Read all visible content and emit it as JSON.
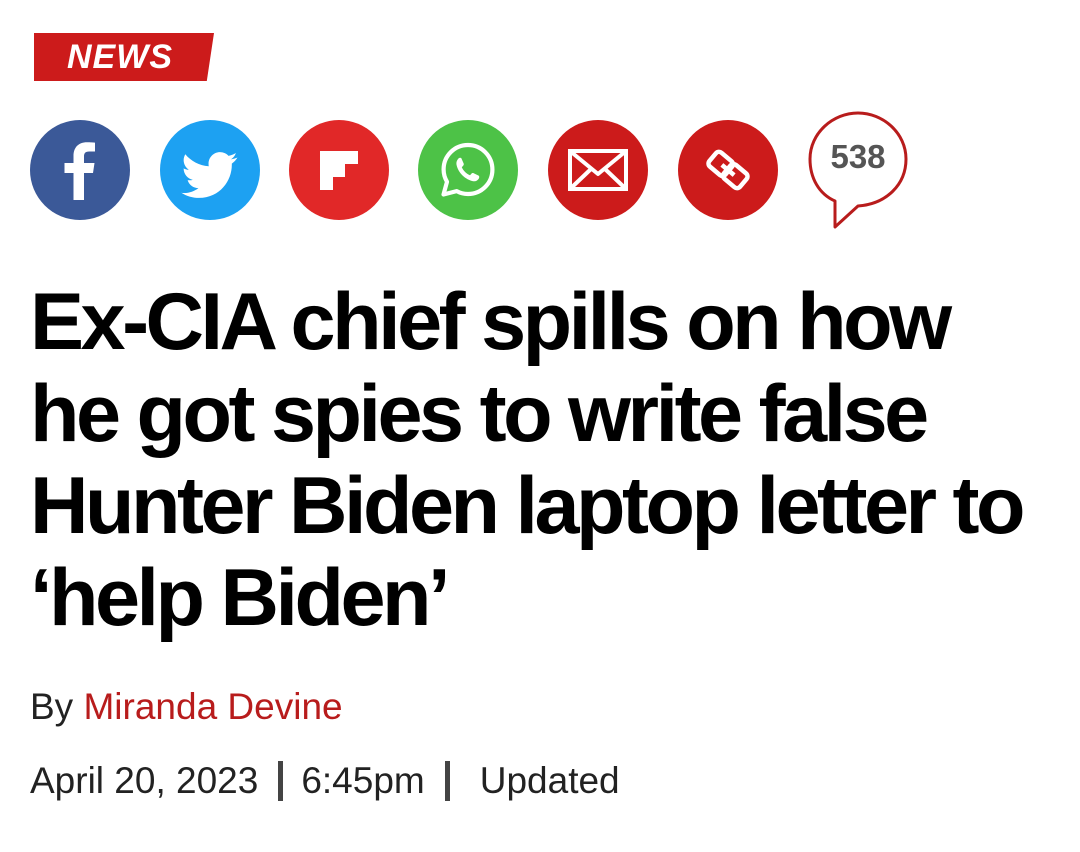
{
  "section": {
    "label": "NEWS",
    "color": "#cc1b1b"
  },
  "share": {
    "buttons": [
      {
        "name": "facebook",
        "icon": "facebook-icon",
        "color": "#3b5998"
      },
      {
        "name": "twitter",
        "icon": "twitter-bird-icon",
        "color": "#1da1f2"
      },
      {
        "name": "flipboard",
        "icon": "flipboard-icon",
        "color": "#e12828"
      },
      {
        "name": "whatsapp",
        "icon": "whatsapp-icon",
        "color": "#4dc247"
      },
      {
        "name": "email",
        "icon": "envelope-icon",
        "color": "#cc1b1b"
      },
      {
        "name": "copy-link",
        "icon": "link-icon",
        "color": "#cc1b1b"
      }
    ],
    "comments": {
      "count": "538",
      "icon": "speech-bubble-icon",
      "border_color": "#b81c1c"
    }
  },
  "article": {
    "headline": "Ex-CIA chief spills on how he got spies to write false Hunter Biden laptop letter to ‘help Biden’",
    "byline_prefix": "By",
    "author": "Miranda Devine",
    "author_color": "#b81c1c",
    "date": "April 20, 2023",
    "time": "6:45pm",
    "updated_label": "Updated"
  }
}
